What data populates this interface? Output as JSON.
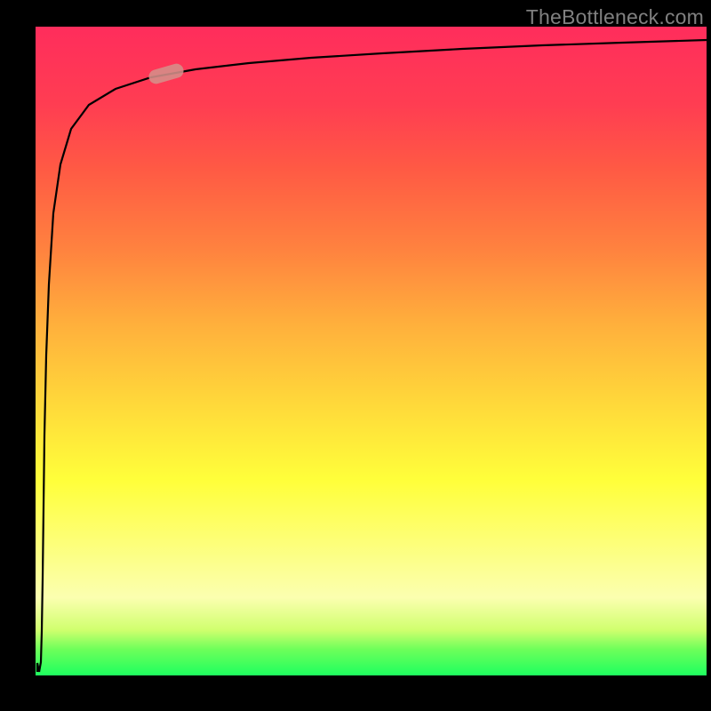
{
  "watermark": "TheBottleneck.com",
  "chart_data": {
    "type": "line",
    "title": "",
    "xlabel": "",
    "ylabel": "",
    "xlim": [
      0,
      100
    ],
    "ylim": [
      0,
      100
    ],
    "grid": false,
    "series": [
      {
        "name": "curve",
        "x": [
          0.6,
          1.0,
          1.5,
          2.0,
          3.0,
          4.0,
          5.0,
          7.0,
          10,
          15,
          20,
          25,
          30,
          40,
          50,
          60,
          70,
          80,
          90,
          100
        ],
        "y": [
          2,
          20,
          40,
          55,
          70,
          78,
          82,
          86,
          88,
          90,
          91,
          92,
          92.5,
          93,
          93.5,
          94,
          94.5,
          95,
          95.5,
          96
        ]
      }
    ],
    "marker": {
      "x": 20,
      "y": 91,
      "color": "#d58f8a",
      "shape": "pill"
    },
    "gradient_stops": [
      {
        "pct": 0,
        "color": "#1eff5f"
      },
      {
        "pct": 4,
        "color": "#6dff5a"
      },
      {
        "pct": 7,
        "color": "#d0ff6e"
      },
      {
        "pct": 12,
        "color": "#fbffb0"
      },
      {
        "pct": 30,
        "color": "#ffff3a"
      },
      {
        "pct": 42,
        "color": "#ffd83a"
      },
      {
        "pct": 54,
        "color": "#ffb03c"
      },
      {
        "pct": 66,
        "color": "#ff813f"
      },
      {
        "pct": 78,
        "color": "#ff5a44"
      },
      {
        "pct": 88,
        "color": "#ff3d52"
      },
      {
        "pct": 100,
        "color": "#ff2d5c"
      }
    ]
  }
}
